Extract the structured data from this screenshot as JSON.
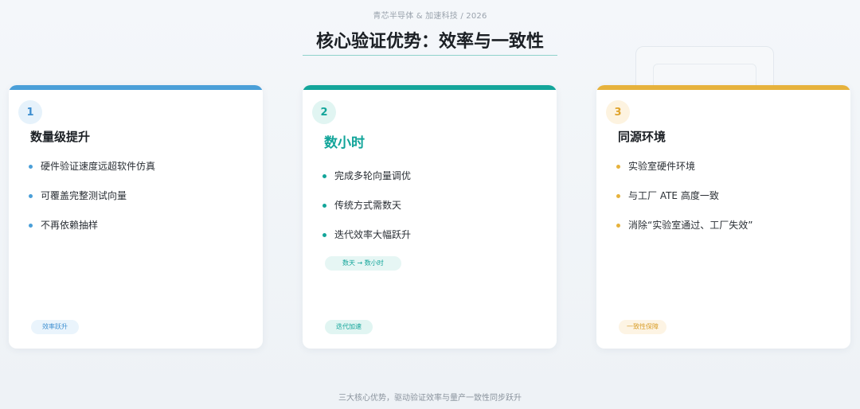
{
  "header": {
    "subtitle": "青芯半导体 & 加速科技 / 2026",
    "title": "核心验证优势：效率与一致性"
  },
  "colors": {
    "blue": "#4a9fd8",
    "teal": "#13a59a",
    "gold": "#e6b23c"
  },
  "cards": [
    {
      "number": "1",
      "title": "数量级提升",
      "bullets": [
        "硬件验证速度远超软件仿真",
        "可覆盖完整测试向量",
        "不再依赖抽样"
      ],
      "tag": "效率跃升"
    },
    {
      "number": "2",
      "title": "数小时",
      "bullets": [
        "完成多轮向量调优",
        "传统方式需数天",
        "迭代效率大幅跃升"
      ],
      "highlight": "数天 → 数小时",
      "tag": "迭代加速"
    },
    {
      "number": "3",
      "title": "同源环境",
      "bullets": [
        "实验室硬件环境",
        "与工厂 ATE 高度一致",
        "消除“实验室通过、工厂失效”"
      ],
      "tag": "一致性保障"
    }
  ],
  "footer": "三大核心优势，驱动验证效率与量产一致性同步跃升"
}
